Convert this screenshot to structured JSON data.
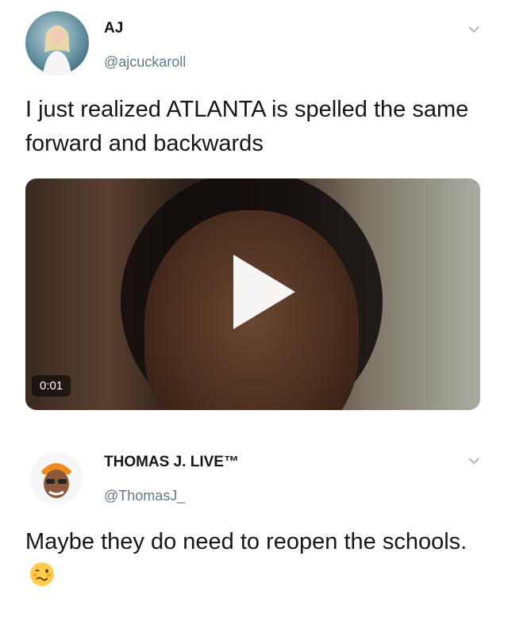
{
  "tweet1": {
    "name": "AJ",
    "handle": "@ajcuckaroll",
    "text": "I just realized ATLANTA is spelled the same forward and backwards",
    "video": {
      "duration": "0:01"
    }
  },
  "tweet2": {
    "name": "THOMAS J. LIVE™",
    "handle": "@ThomasJ_",
    "text": "Maybe they do need to reopen the schools."
  }
}
